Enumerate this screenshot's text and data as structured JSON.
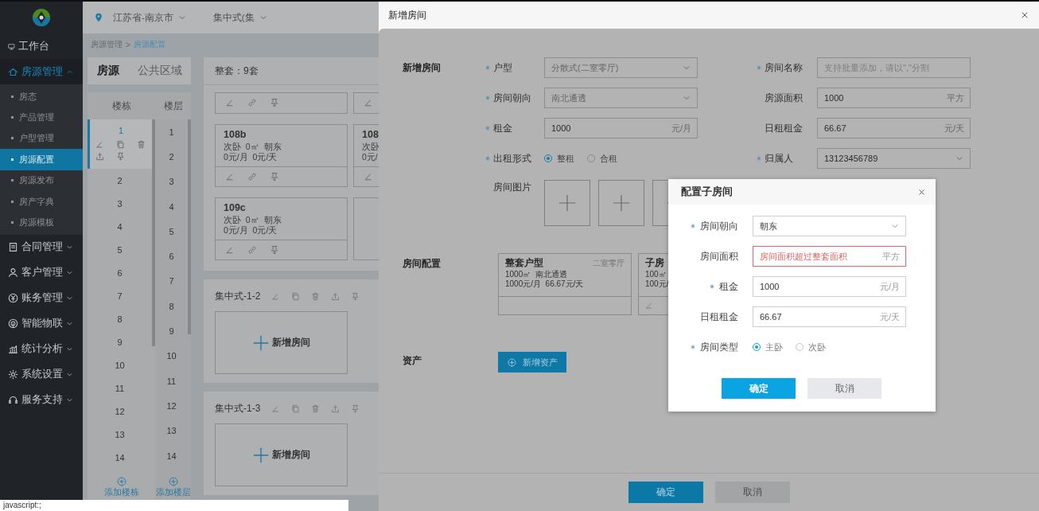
{
  "sidebar": {
    "items": [
      {
        "kind": "link",
        "label": "工作台",
        "selected": false
      },
      {
        "kind": "group",
        "label": "房源管理",
        "selected": true,
        "expanded": true,
        "children": [
          {
            "label": "房态",
            "selected": false
          },
          {
            "label": "产品管理",
            "selected": false
          },
          {
            "label": "户型管理",
            "selected": false
          },
          {
            "label": "房源配置",
            "selected": true
          },
          {
            "label": "房源发布",
            "selected": false
          },
          {
            "label": "房产字典",
            "selected": false
          },
          {
            "label": "房源模板",
            "selected": false
          }
        ]
      },
      {
        "kind": "group",
        "label": "合同管理",
        "selected": false,
        "expanded": false
      },
      {
        "kind": "group",
        "label": "客户管理",
        "selected": false,
        "expanded": false
      },
      {
        "kind": "group",
        "label": "账务管理",
        "selected": false,
        "expanded": false
      },
      {
        "kind": "group",
        "label": "智能物联",
        "selected": false,
        "expanded": false
      },
      {
        "kind": "group",
        "label": "统计分析",
        "selected": false,
        "expanded": false
      },
      {
        "kind": "group",
        "label": "系统设置",
        "selected": false,
        "expanded": false
      },
      {
        "kind": "group",
        "label": "服务支持",
        "selected": false,
        "expanded": false
      }
    ]
  },
  "topbar": {
    "location": "江苏省-南京市",
    "project": "集中式(集"
  },
  "breadcrumb": {
    "separator": ">",
    "items": [
      {
        "label": "房源管理",
        "selected": false
      },
      {
        "label": "房源配置",
        "selected": true
      }
    ]
  },
  "tabs": [
    {
      "label": "房源",
      "selected": true
    },
    {
      "label": "公共区域",
      "selected": false
    }
  ],
  "buildings": {
    "heading": "楼栋",
    "add_label": "添加楼栋",
    "items": [
      {
        "label": "1",
        "selected": true
      },
      {
        "label": "2",
        "selected": false
      },
      {
        "label": "3",
        "selected": false
      },
      {
        "label": "4",
        "selected": false
      },
      {
        "label": "5",
        "selected": false
      },
      {
        "label": "6",
        "selected": false
      },
      {
        "label": "7",
        "selected": false
      },
      {
        "label": "8",
        "selected": false
      },
      {
        "label": "9",
        "selected": false
      },
      {
        "label": "10",
        "selected": false
      },
      {
        "label": "11",
        "selected": false
      },
      {
        "label": "12",
        "selected": false
      },
      {
        "label": "13",
        "selected": false
      },
      {
        "label": "14",
        "selected": false
      }
    ]
  },
  "floors": {
    "heading": "楼层",
    "add_label": "添加楼层",
    "items": [
      "1",
      "2",
      "3",
      "4",
      "5",
      "6",
      "7",
      "8",
      "9",
      "10",
      "11",
      "12",
      "13",
      "14"
    ]
  },
  "rooms_panel": {
    "summary": "整套：9套",
    "rooms": [
      {
        "kind": "footer-only"
      },
      {
        "kind": "footer-only"
      },
      {
        "kind": "room",
        "title": "108b",
        "lines": [
          "次卧  0㎡  朝东",
          "0元/月  0元/天"
        ]
      },
      {
        "kind": "room",
        "title": "108",
        "lines": [
          "次卧",
          "0元/"
        ]
      },
      {
        "kind": "room",
        "title": "109c",
        "lines": [
          "次卧  0㎡  朝东",
          "0元/月  0元/天"
        ]
      },
      {
        "kind": "empty"
      }
    ],
    "groups": [
      {
        "name": "集中式-1-2",
        "add_label": "新增房间"
      },
      {
        "name": "集中式-1-3",
        "add_label": "新增房间"
      }
    ]
  },
  "status_bar": "javascript:;",
  "dialog": {
    "title": "新增房间",
    "section_title": "新增房间",
    "left_fields": [
      {
        "kind": "select",
        "label": "户型",
        "required": true,
        "value": "分散式(二室零厅)",
        "disabled": true
      },
      {
        "kind": "select",
        "label": "房间朝向",
        "required": true,
        "value": "南北通透",
        "disabled": true
      },
      {
        "kind": "input",
        "label": "租金",
        "required": true,
        "value": "1000",
        "unit": "元/月"
      },
      {
        "kind": "radio",
        "label": "出租形式",
        "required": true,
        "options": [
          {
            "label": "整租",
            "selected": true
          },
          {
            "label": "合租",
            "selected": false
          }
        ]
      },
      {
        "kind": "upload",
        "label": "房间图片",
        "required": false,
        "slots": [
          {
            "kind": "empty"
          },
          {
            "kind": "empty"
          },
          {
            "kind": "empty"
          }
        ]
      }
    ],
    "right_fields": [
      {
        "kind": "input",
        "label": "房间名称",
        "required": true,
        "placeholder": "支持批量添加，请以\",\"分割"
      },
      {
        "kind": "input",
        "label": "房源面积",
        "required": false,
        "value": "1000",
        "unit": "平方"
      },
      {
        "kind": "input",
        "label": "日租租金",
        "required": false,
        "value": "66.67",
        "unit": "元/天"
      },
      {
        "kind": "select",
        "label": "归属人",
        "required": true,
        "value": "13123456789",
        "disabled": false
      }
    ],
    "config_title": "房间配置",
    "config_cards": [
      {
        "title": "整套户型",
        "tag": "二室零厅",
        "lines": [
          "1000㎡  南北通透",
          "1000元/月  66.67元/天"
        ],
        "editable": false
      },
      {
        "title": "子房",
        "lines": [
          "100㎡",
          "100元/"
        ],
        "editable": true
      }
    ],
    "assets_title": "资产",
    "add_asset_label": "新增资产",
    "buttons": [
      {
        "label": "确定",
        "kind": "primary"
      },
      {
        "label": "取消",
        "kind": "secondary"
      }
    ]
  },
  "sub_dialog": {
    "title": "配置子房间",
    "fields": [
      {
        "kind": "select",
        "label": "房间朝向",
        "required": true,
        "value": "朝东",
        "disabled": false
      },
      {
        "kind": "input",
        "label": "房间面积",
        "required": false,
        "placeholder": "房间面积超过整套面积",
        "unit": "平方",
        "invalid": true
      },
      {
        "kind": "input",
        "label": "租金",
        "required": true,
        "value": "1000",
        "unit": "元/月",
        "invalid": false
      },
      {
        "kind": "input",
        "label": "日租租金",
        "required": false,
        "value": "66.67",
        "unit": "元/天",
        "invalid": false
      },
      {
        "kind": "radio",
        "label": "房间类型",
        "required": true,
        "options": [
          {
            "label": "主卧",
            "selected": true
          },
          {
            "label": "次卧",
            "selected": false
          }
        ]
      }
    ],
    "buttons": [
      {
        "label": "确定",
        "kind": "primary"
      },
      {
        "label": "取消",
        "kind": "secondary"
      }
    ]
  }
}
